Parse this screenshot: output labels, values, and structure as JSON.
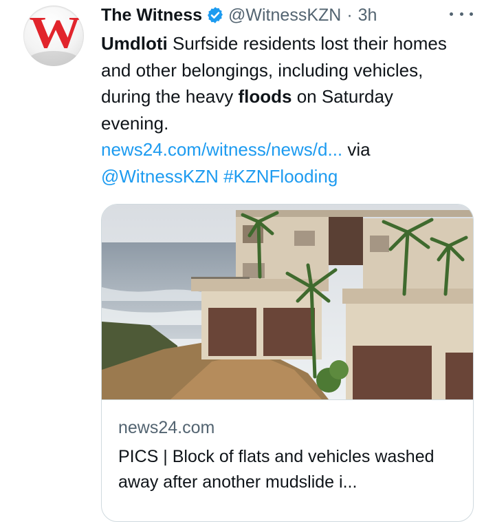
{
  "tweet": {
    "author": {
      "display_name": "The Witness",
      "handle": "@WitnessKZN",
      "verified": true,
      "avatar_letter": "W",
      "avatar_color": "#e1252c"
    },
    "separator": "·",
    "time": "3h",
    "text": {
      "bold1": "Umdloti",
      "part1": " Surfside residents lost their homes and other belongings, including vehicles, during the heavy ",
      "bold2": "floods",
      "part2": " on Saturday evening.",
      "link_url_text": "news24.com/witness/news/d...",
      "via": " via ",
      "mention": "@WitnessKZN",
      "hashtag": "#KZNFlooding"
    },
    "card": {
      "image_icon": "flood-damaged-building-photo",
      "domain": "news24.com",
      "title": "PICS | Block of flats and vehicles washed away after another mudslide i..."
    }
  },
  "colors": {
    "link": "#1d9bf0",
    "secondary_text": "#536471",
    "border": "#cfd9de",
    "verified_badge": "#1d9bf0"
  }
}
